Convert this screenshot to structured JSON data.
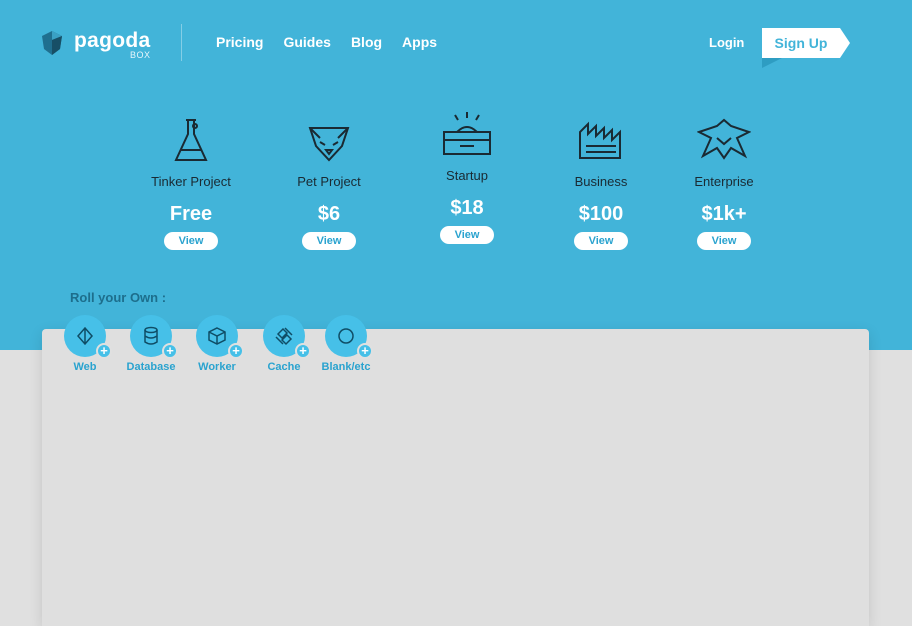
{
  "brand": {
    "name": "pagoda",
    "sub": "BOX"
  },
  "nav": {
    "items": [
      "Pricing",
      "Guides",
      "Blog",
      "Apps"
    ],
    "login": "Login",
    "signup": "Sign Up"
  },
  "plans": [
    {
      "name": "Tinker Project",
      "price": "Free",
      "button": "View",
      "icon": "flask-icon"
    },
    {
      "name": "Pet Project",
      "price": "$6",
      "button": "View",
      "icon": "pet-face-icon"
    },
    {
      "name": "Startup",
      "price": "$18",
      "button": "View",
      "icon": "startup-box-icon"
    },
    {
      "name": "Business",
      "price": "$100",
      "button": "View",
      "icon": "factory-icon"
    },
    {
      "name": "Enterprise",
      "price": "$1k+",
      "button": "View",
      "icon": "eagle-icon"
    }
  ],
  "roll": {
    "label": "Roll your Own :"
  },
  "components": [
    {
      "label": "Web",
      "icon": "web-diamond-icon"
    },
    {
      "label": "Database",
      "icon": "database-icon"
    },
    {
      "label": "Worker",
      "icon": "worker-cube-icon"
    },
    {
      "label": "Cache",
      "icon": "cache-icon"
    },
    {
      "label": "Blank/etc",
      "icon": "blank-circle-icon"
    }
  ],
  "colors": {
    "brand": "#42b4d9",
    "accent": "#46c0e8",
    "background": "#e0e0e0"
  }
}
